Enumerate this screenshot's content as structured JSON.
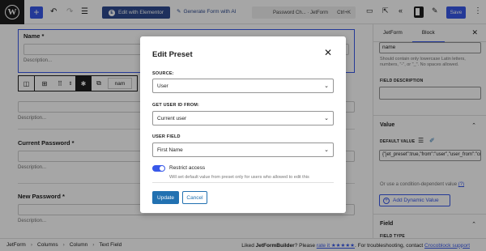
{
  "topbar": {
    "logo_letter": "W",
    "add_icon": "plus-icon",
    "undo_icon": "undo-icon",
    "redo_icon": "redo-icon",
    "list_view_icon": "list-view-icon",
    "elementor_button": "Edit with Elementor",
    "elementor_mark": "E",
    "generate_ai": "Generate Form with AI",
    "document_title": "Password Ch... · JetForm",
    "shortcut": "Ctrl+K",
    "save_label": "Save",
    "accent_color": "#3858e9"
  },
  "canvas": {
    "field1": {
      "label": "Name *",
      "description": "Description..."
    },
    "field2": {
      "description": "Description..."
    },
    "field3": {
      "label": "Current Password *",
      "description": "Description..."
    },
    "field4": {
      "label": "New Password *",
      "description": "Description..."
    },
    "toolbar_name_text": "nam"
  },
  "sidebar": {
    "tabs": [
      "JetForm",
      "Block"
    ],
    "active_tab": "Block",
    "name_value": "name",
    "name_help": "Should contain only lowercase Latin letters, numbers, \"-\", or \"_\". No spaces allowed.",
    "field_description_label": "FIELD DESCRIPTION",
    "value_section": "Value",
    "default_value_label": "DEFAULT VALUE",
    "default_value": "{\"jet_preset\":true,\"from\":\"user\",\"user_from\":\"current\"}",
    "condition_text": "Or use a condition-dependent value",
    "condition_link": "(?)",
    "add_dynamic": "Add Dynamic Value",
    "field_section": "Field",
    "field_type_label": "FIELD TYPE"
  },
  "footer": {
    "crumbs": [
      "JetForm",
      "Columns",
      "Column",
      "Text Field"
    ],
    "liked_prefix": "Liked ",
    "liked_brand": "JetFormBuilder",
    "liked_mid": "? Please ",
    "rate_link": "rate it ★★★★★",
    "troubleshoot": ". For troubleshooting, contact ",
    "support_link": "Crocoblock support"
  },
  "modal": {
    "title": "Edit Preset",
    "source_label": "SOURCE:",
    "source_value": "User",
    "user_id_label": "GET USER ID FROM:",
    "user_id_value": "Current user",
    "user_field_label": "USER FIELD",
    "user_field_value": "First Name",
    "restrict_label": "Restrict access",
    "restrict_on": true,
    "restrict_help": "Will set default value from preset only for users who allowed to edit this",
    "update_label": "Update",
    "cancel_label": "Cancel",
    "primary_color": "#2271b1"
  }
}
